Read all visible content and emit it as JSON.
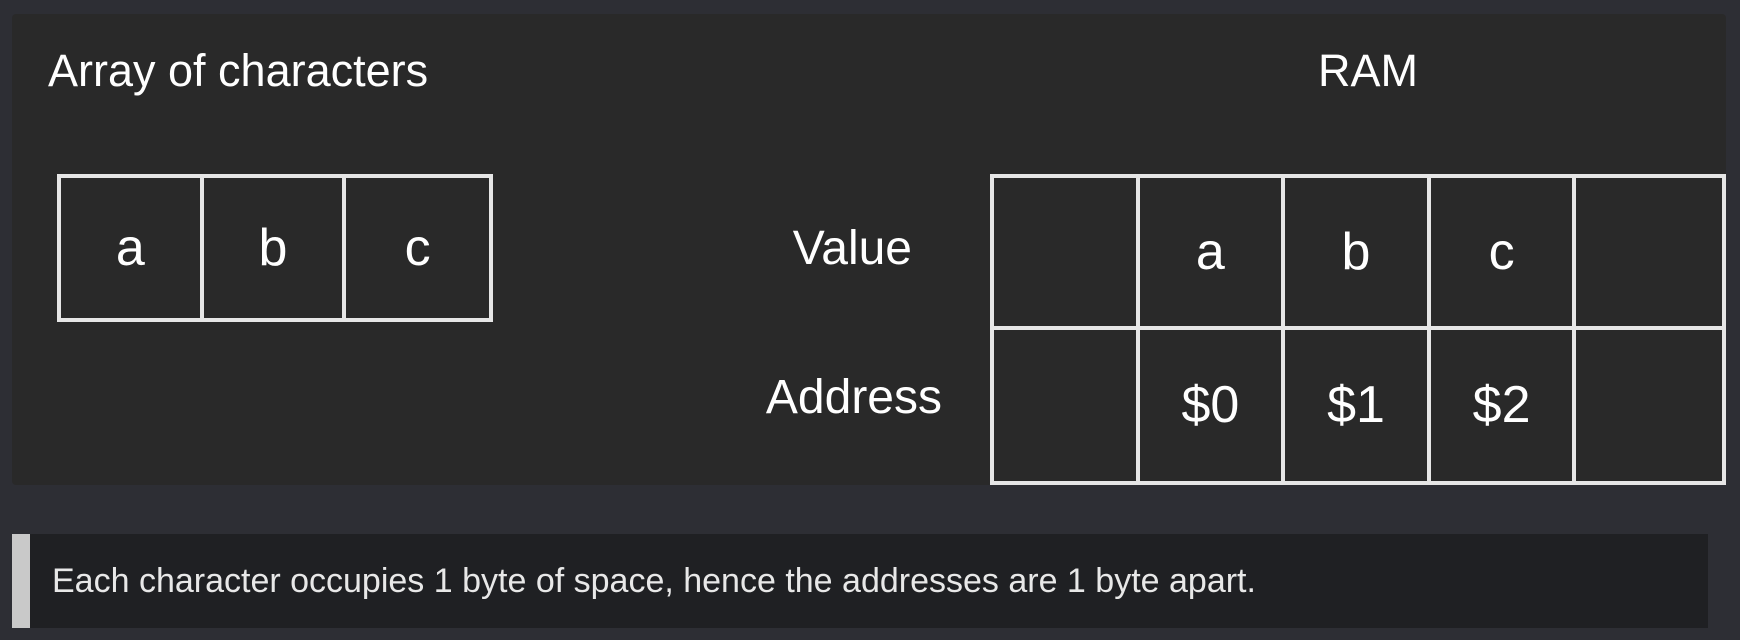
{
  "diagram": {
    "left_title": "Array of characters",
    "array_cells": [
      "a",
      "b",
      "c"
    ],
    "ram_title": "RAM",
    "value_label": "Value",
    "address_label": "Address",
    "ram_values": [
      "",
      "a",
      "b",
      "c",
      ""
    ],
    "ram_addresses": [
      "",
      "$0",
      "$1",
      "$2",
      ""
    ]
  },
  "note": {
    "text": "Each character occupies 1 byte of space, hence the addresses are 1 byte apart."
  },
  "colors": {
    "background": "#2d2e34",
    "panel": "#292929",
    "grid_lines": "#e6e6e6",
    "note_bar": "#c9c9c9",
    "note_background": "#1f2023"
  }
}
